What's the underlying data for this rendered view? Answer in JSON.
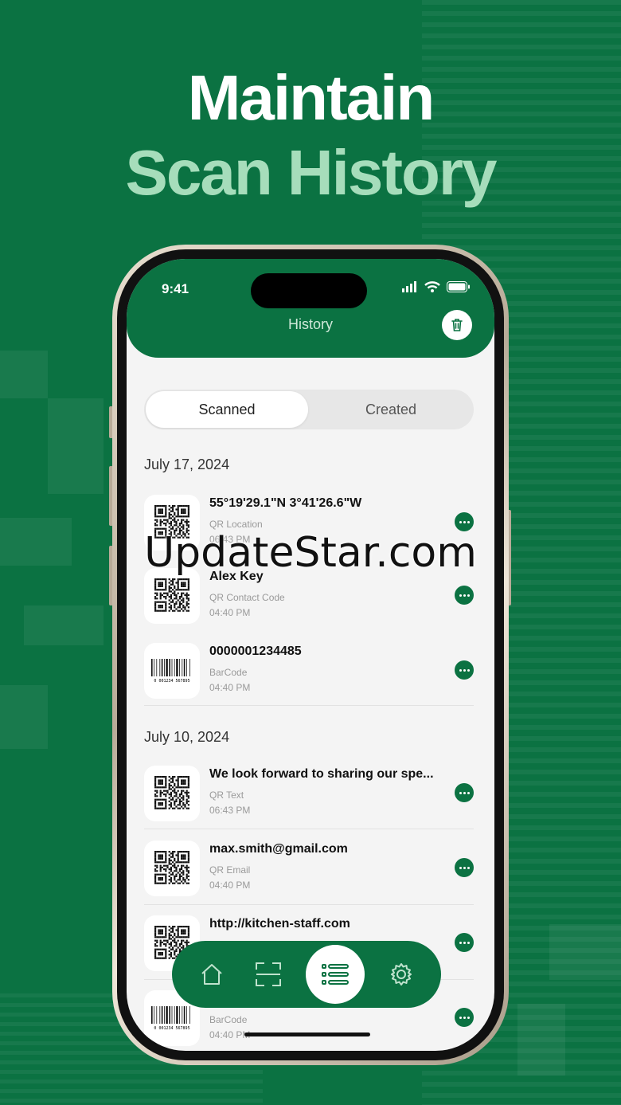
{
  "headline": {
    "line1": "Maintain",
    "line2": "Scan History"
  },
  "status_bar": {
    "time": "9:41"
  },
  "header": {
    "title": "History",
    "trash_icon": "trash-icon"
  },
  "segments": {
    "active": "Scanned",
    "inactive": "Created"
  },
  "groups": [
    {
      "date": "July 17, 2024",
      "items": [
        {
          "title": "55°19'29.1\"N 3°41'26.6\"W",
          "type": "QR Location",
          "time": "06:43 PM",
          "thumb": "qr-code-icon"
        },
        {
          "title": "Alex Key",
          "type": "QR Contact Code",
          "time": "04:40 PM",
          "thumb": "qr-code-icon"
        },
        {
          "title": "0000001234485",
          "type": "BarCode",
          "time": "04:40 PM",
          "thumb": "barcode-icon"
        }
      ]
    },
    {
      "date": "July 10, 2024",
      "items": [
        {
          "title": "We look forward to sharing our spe...",
          "type": "QR Text",
          "time": "06:43 PM",
          "thumb": "qr-code-icon"
        },
        {
          "title": "max.smith@gmail.com",
          "type": "QR Email",
          "time": "04:40 PM",
          "thumb": "qr-code-icon"
        },
        {
          "title": "http://kitchen-staff.com",
          "type": "",
          "time": "",
          "thumb": "qr-code-icon"
        },
        {
          "title": "",
          "type": "BarCode",
          "time": "04:40 PM",
          "thumb": "barcode-icon"
        }
      ]
    }
  ],
  "barcode_digits": "0 001234 567895",
  "tabbar": {
    "tabs": [
      "home-icon",
      "scan-icon",
      "history-list-icon",
      "settings-gear-icon"
    ],
    "active": "history-list-icon"
  },
  "watermark": "UpdateStar.com",
  "colors": {
    "brand": "#0b7242",
    "accent_light": "#a6ddbb"
  }
}
